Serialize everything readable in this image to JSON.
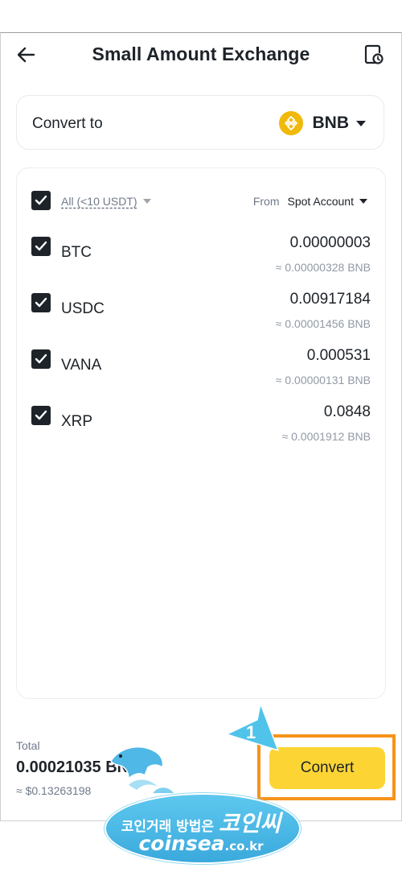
{
  "header": {
    "title": "Small Amount Exchange",
    "back_icon": "arrow-left-icon",
    "history_icon": "order-history-icon"
  },
  "convert_to": {
    "label": "Convert to",
    "coin": "BNB",
    "coin_icon": "bnb-logo-icon"
  },
  "filter": {
    "all_label": "All (<10 USDT)",
    "from_label": "From",
    "account": "Spot Account"
  },
  "assets": [
    {
      "symbol": "BTC",
      "amount": "0.00000003",
      "converted": "≈ 0.00000328 BNB",
      "checked": true
    },
    {
      "symbol": "USDC",
      "amount": "0.00917184",
      "converted": "≈ 0.00001456 BNB",
      "checked": true
    },
    {
      "symbol": "VANA",
      "amount": "0.000531",
      "converted": "≈ 0.00000131 BNB",
      "checked": true
    },
    {
      "symbol": "XRP",
      "amount": "0.0848",
      "converted": "≈ 0.0001912 BNB",
      "checked": true
    }
  ],
  "footer": {
    "total_label": "Total",
    "total_value": "0.00021035 BNB",
    "total_usd": "≈ $0.13263198",
    "convert_label": "Convert"
  },
  "annotation": {
    "step": "1",
    "highlight_color": "#f7931a"
  },
  "watermark": {
    "korean": "코인거래 방법은",
    "brand_korean": "코인씨",
    "domain": "coinsea",
    "tld": ".co.kr"
  },
  "colors": {
    "accent": "#fcd535",
    "bnb": "#f0b90b",
    "text": "#1e2329",
    "muted": "#707a8a"
  }
}
